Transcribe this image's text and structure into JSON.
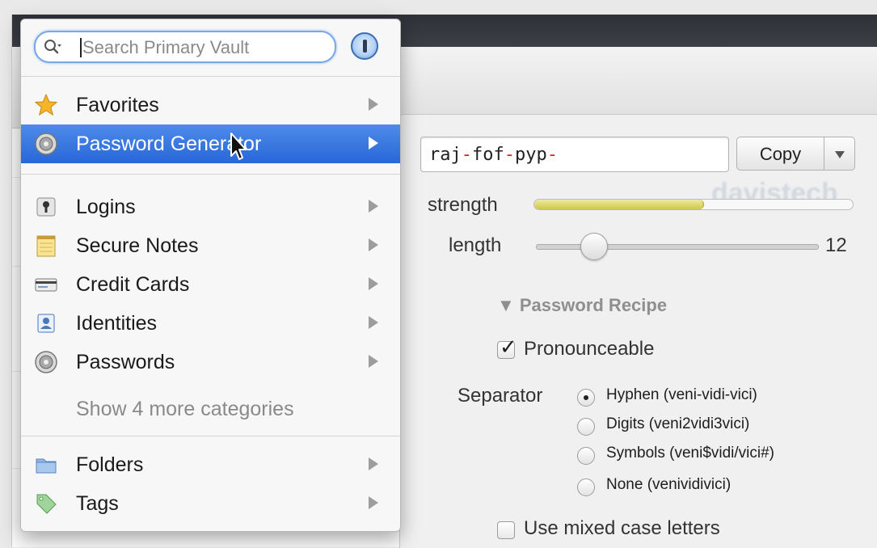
{
  "search": {
    "placeholder": "Search Primary Vault"
  },
  "menu": {
    "favorites": "Favorites",
    "password_generator": "Password Generator",
    "logins": "Logins",
    "secure_notes": "Secure Notes",
    "credit_cards": "Credit Cards",
    "identities": "Identities",
    "passwords": "Passwords",
    "more_categories": "Show 4 more categories",
    "folders": "Folders",
    "tags": "Tags"
  },
  "generator": {
    "password_parts": [
      "raj",
      "-",
      "fof",
      "-",
      "pyp",
      "-"
    ],
    "copy_label": "Copy",
    "strength_label": "strength",
    "strength_fraction": 0.53,
    "length_label": "length",
    "length_value": "12",
    "length_min": 4,
    "length_max": 50,
    "recipe_title": "▼ Password Recipe",
    "pronounceable_label": "Pronounceable",
    "pronounceable_checked": true,
    "separator_label": "Separator",
    "separator_options": [
      {
        "label": "Hyphen (veni-vidi-vici)",
        "selected": true
      },
      {
        "label": "Digits (veni2vidi3vici)",
        "selected": false
      },
      {
        "label": "Symbols (veni$vidi/vici#)",
        "selected": false
      },
      {
        "label": "None (venividivici)",
        "selected": false
      }
    ],
    "mixed_case_label": "Use mixed case letters",
    "mixed_case_checked": false
  },
  "colors": {
    "selection": "#2f6fdd",
    "separator_red": "#d9261c",
    "strength_fill": "#d6cf57"
  }
}
